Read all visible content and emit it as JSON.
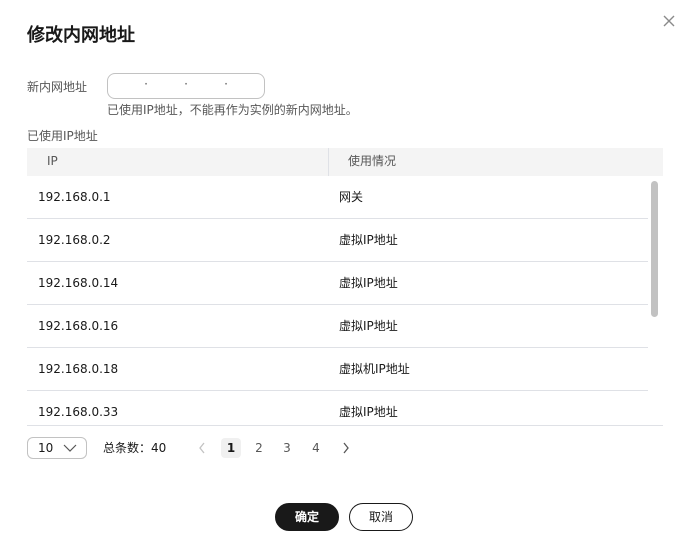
{
  "dialog": {
    "title": "修改内网地址",
    "close_icon": "close-icon"
  },
  "form": {
    "ip_label": "新内网地址",
    "ip_segments": [
      "",
      "",
      "",
      ""
    ],
    "ip_separator": "·",
    "hint": "已使用IP地址，不能再作为实例的新内网地址。"
  },
  "used_ips": {
    "section_label": "已使用IP地址",
    "columns": [
      "IP",
      "使用情况"
    ],
    "rows": [
      {
        "ip": "192.168.0.1",
        "usage": "网关"
      },
      {
        "ip": "192.168.0.2",
        "usage": "虚拟IP地址"
      },
      {
        "ip": "192.168.0.14",
        "usage": "虚拟IP地址"
      },
      {
        "ip": "192.168.0.16",
        "usage": "虚拟IP地址"
      },
      {
        "ip": "192.168.0.18",
        "usage": "虚拟机IP地址"
      },
      {
        "ip": "192.168.0.33",
        "usage": "虚拟IP地址"
      }
    ]
  },
  "pagination": {
    "page_size": "10",
    "total_label": "总条数：40",
    "pages": [
      "1",
      "2",
      "3",
      "4"
    ],
    "current_page": "1",
    "prev_icon": "chevron-left-icon",
    "next_icon": "chevron-right-icon"
  },
  "footer": {
    "confirm_label": "确定",
    "cancel_label": "取消"
  },
  "colors": {
    "primary_button": "#191919",
    "border": "#c2c2c2",
    "header_bg": "#f4f4f4",
    "divider": "#dfe1e6"
  }
}
